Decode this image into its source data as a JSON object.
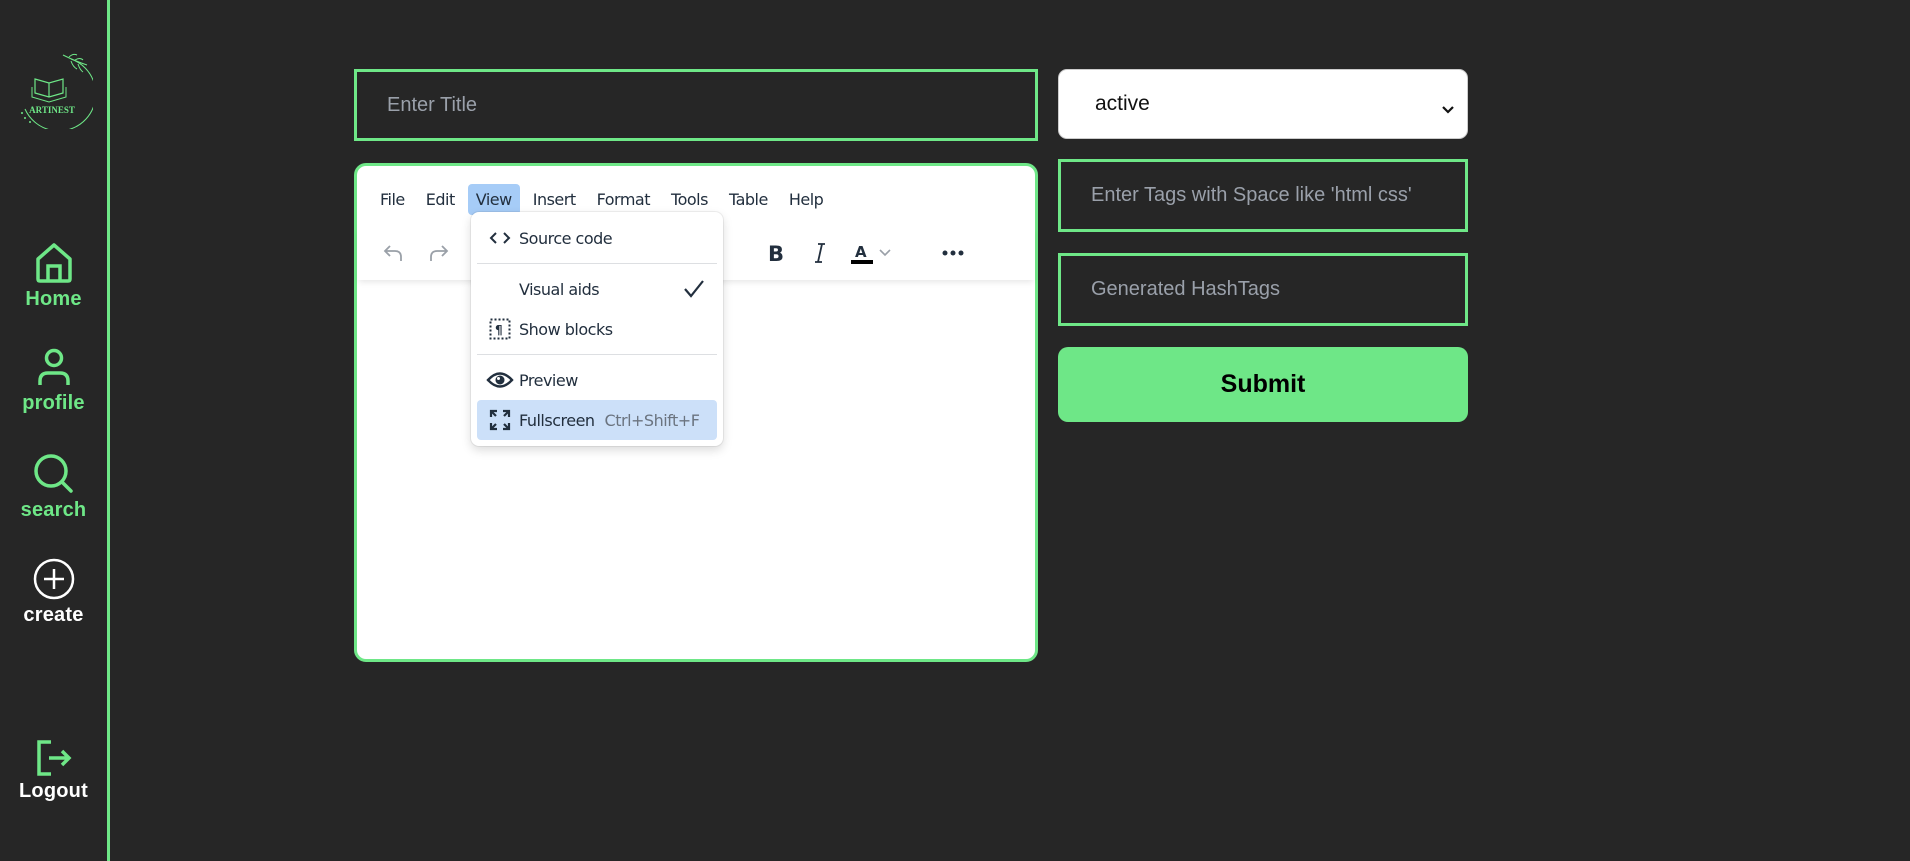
{
  "app": {
    "name": "ARTINEST",
    "accent_color": "#6ee787",
    "background_color": "#262626"
  },
  "sidebar": {
    "logo_text": "ARTINEST",
    "items": [
      {
        "label": "Home",
        "icon": "home-icon",
        "color": "#6ee787"
      },
      {
        "label": "profile",
        "icon": "user-icon",
        "color": "#6ee787"
      },
      {
        "label": "search",
        "icon": "search-icon",
        "color": "#6ee787"
      },
      {
        "label": "create",
        "icon": "plus-circle-icon",
        "color": "#ffffff"
      }
    ],
    "logout": {
      "label": "Logout",
      "icon": "logout-icon"
    }
  },
  "form": {
    "title": {
      "placeholder": "Enter Title",
      "value": ""
    },
    "status": {
      "selected": "active"
    },
    "tags": {
      "placeholder": "Enter Tags with Space like 'html css'",
      "value": ""
    },
    "hashtags": {
      "placeholder": "Generated HashTags",
      "value": ""
    },
    "submit_label": "Submit"
  },
  "editor": {
    "menubar": [
      "File",
      "Edit",
      "View",
      "Insert",
      "Format",
      "Tools",
      "Table",
      "Help"
    ],
    "active_menu": "View",
    "toolbar": [
      "undo-icon",
      "redo-icon",
      "bold-icon",
      "italic-icon",
      "text-color-icon",
      "chevron-down-icon",
      "more-icon"
    ],
    "content": "",
    "view_menu": {
      "items": [
        {
          "label": "Source code",
          "icon": "source-code-icon"
        },
        {
          "label": "Visual aids",
          "checked": true
        },
        {
          "label": "Show blocks",
          "icon": "show-blocks-icon"
        },
        {
          "label": "Preview",
          "icon": "eye-icon"
        },
        {
          "label": "Fullscreen",
          "icon": "fullscreen-icon",
          "shortcut": "Ctrl+Shift+F",
          "highlighted": true
        }
      ]
    }
  }
}
